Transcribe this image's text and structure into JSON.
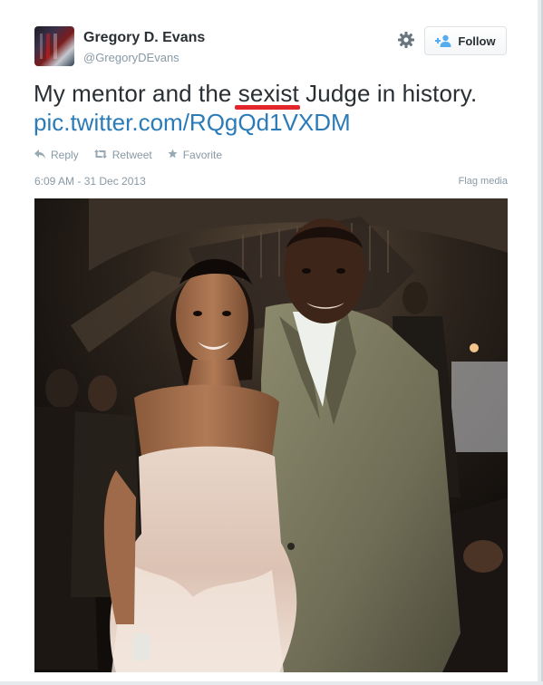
{
  "tweet": {
    "author_name": "Gregory D. Evans",
    "author_handle": "@GregoryDEvans",
    "follow_label": "Follow",
    "text_before": "My mentor and the ",
    "text_highlight": "sexist",
    "text_after": " Judge in history.",
    "link": "pic.twitter.com/RQgQd1VXDM",
    "actions": [
      {
        "icon": "reply-icon",
        "label": "Reply"
      },
      {
        "icon": "retweet-icon",
        "label": "Retweet"
      },
      {
        "icon": "favorite-star-icon",
        "label": "Favorite"
      }
    ],
    "timestamp": "6:09 AM - 31 Dec 2013",
    "flag_label": "Flag media"
  },
  "colors": {
    "link": "#2b7bb9",
    "muted": "#8899a6",
    "text": "#292f33",
    "spellcheck_underline": "#e4262c"
  },
  "icons": {
    "settings": "gear-icon",
    "follow": "add-user-icon"
  }
}
